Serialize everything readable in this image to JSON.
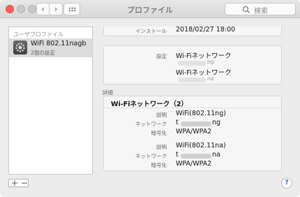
{
  "window": {
    "title": "プロファイル"
  },
  "toolbar": {
    "back": "‹",
    "forward": "›",
    "search_placeholder": "検索"
  },
  "sidebar": {
    "header": "ユーザプロファイル",
    "items": [
      {
        "name": "WiFi 802.11nagb",
        "subtitle": "2個の設定"
      }
    ]
  },
  "detail": {
    "install": {
      "label": "インストール",
      "value": "2018/02/27 18:00"
    },
    "settings": {
      "label": "設定",
      "entries": [
        {
          "title": "Wi-Fiネットワーク",
          "ssid_suffix": "ng"
        },
        {
          "title": "Wi-Fiネットワーク",
          "ssid_suffix": "na"
        }
      ]
    },
    "details_label": "詳細",
    "network_card": {
      "title": "Wi-Fiネットワーク（2）",
      "groups": [
        {
          "desc_label": "説明",
          "desc": "WiFi(802.11ng)",
          "net_label": "ネットワーク",
          "net_prefix": "t",
          "net_suffix": "ng",
          "enc_label": "暗号化",
          "enc": "WPA/WPA2"
        },
        {
          "desc_label": "説明",
          "desc": "WiFi(802.11na)",
          "net_label": "ネットワーク",
          "net_prefix": "t",
          "net_suffix": "na",
          "enc_label": "暗号化",
          "enc": "WPA/WPA2"
        }
      ]
    }
  },
  "bottom": {
    "add": "+",
    "remove": "−",
    "help": "?"
  }
}
